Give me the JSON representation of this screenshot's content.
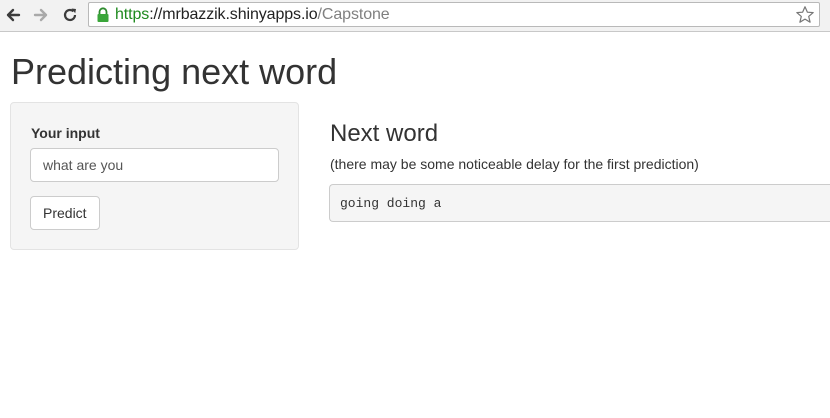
{
  "browser": {
    "back_icon": "arrow-left-icon",
    "forward_icon": "arrow-right-icon",
    "reload_icon": "reload-icon",
    "lock_icon": "lock-icon",
    "bookmark_icon": "star-icon",
    "url_scheme": "https",
    "url_host": "://mrbazzik.shinyapps.io",
    "url_path": "/Capstone",
    "colors": {
      "secure_green": "#1e8a1e",
      "path_gray": "#808080"
    }
  },
  "page": {
    "title": "Predicting next word"
  },
  "sidebar": {
    "input_label": "Your input",
    "input_value": "what are you",
    "predict_label": "Predict"
  },
  "main": {
    "heading": "Next word",
    "note": "(there may be some noticeable delay for the first prediction)",
    "prediction": "going doing a"
  }
}
